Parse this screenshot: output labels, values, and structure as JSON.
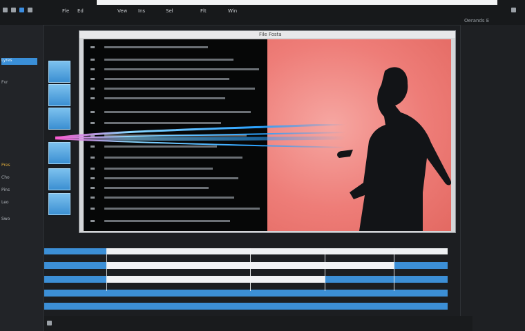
{
  "toolbar": {
    "menu_items": [
      "Fle",
      "Ed",
      "Vew",
      "Ins",
      "Sel",
      "Flt",
      "Win"
    ],
    "top_right_label": "Oerands E"
  },
  "preview": {
    "title": "File Fosta"
  },
  "sidebar": {
    "items": [
      {
        "label": "Lyres",
        "active": true
      },
      {
        "label": "Fvr"
      },
      {
        "label": "Pres",
        "gold": true
      },
      {
        "label": "Cho"
      },
      {
        "label": "Pins"
      },
      {
        "label": "Leo"
      },
      {
        "label": "Swo"
      }
    ]
  },
  "colors": {
    "accent": "#3c8fd6",
    "art_background": "#ee7d78",
    "beam": "#38b8ff",
    "dark_bg": "#1c1e21"
  },
  "icons": [
    "arrow-icon",
    "folder-icon",
    "scissors-icon",
    "search-icon",
    "gear-icon",
    "play-icon"
  ]
}
